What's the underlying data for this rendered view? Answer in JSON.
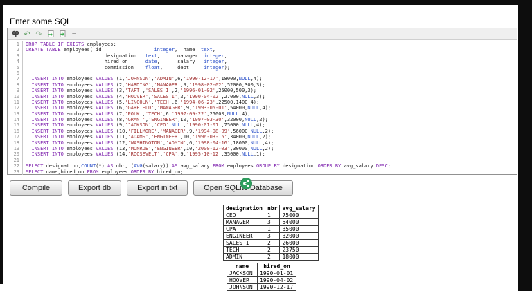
{
  "title": "Enter some SQL",
  "colors": {
    "keyword": "#7d21ad",
    "type": "#2b50c8",
    "string": "#a23333",
    "plain": "#1c1c1c",
    "accent_green": "#2e9e5e"
  },
  "editor": {
    "toolbar_icons": [
      "search",
      "undo",
      "redo",
      "load-file",
      "save-file",
      "highlight"
    ],
    "lines": [
      "DROP TABLE IF EXISTS employees;",
      "CREATE TABLE employees( id                  integer,  name  text,",
      "                           designation   text,      manager  integer,",
      "                           hired_on      date,      salary   integer,",
      "                           commission    float,     dept     integer);",
      "",
      "  INSERT INTO employees VALUES (1,'JOHNSON','ADMIN',6,'1990-12-17',18000,NULL,4);",
      "  INSERT INTO employees VALUES (2,'HARDING','MANAGER',9,'1998-02-02',52000,300,3);",
      "  INSERT INTO employees VALUES (3,'TAFT','SALES I',2,'1996-01-02',25000,500,3);",
      "  INSERT INTO employees VALUES (4,'HOOVER','SALES I',2,'1990-04-02',27000,NULL,3);",
      "  INSERT INTO employees VALUES (5,'LINCOLN','TECH',6,'1994-06-23',22500,1400,4);",
      "  INSERT INTO employees VALUES (6,'GARFIELD','MANAGER',9,'1993-05-01',54000,NULL,4);",
      "  INSERT INTO employees VALUES (7,'POLK','TECH',6,'1997-09-22',25000,NULL,4);",
      "  INSERT INTO employees VALUES (8,'GRANT','ENGINEER',10,'1997-03-30',32000,NULL,2);",
      "  INSERT INTO employees VALUES (9,'JACKSON','CEO',NULL,'1990-01-01',75000,NULL,4);",
      "  INSERT INTO employees VALUES (10,'FILLMORE','MANAGER',9,'1994-08-09',56000,NULL,2);",
      "  INSERT INTO employees VALUES (11,'ADAMS','ENGINEER',10,'1996-03-15',34000,NULL,2);",
      "  INSERT INTO employees VALUES (12,'WASHINGTON','ADMIN',6,'1998-04-16',18000,NULL,4);",
      "  INSERT INTO employees VALUES (13,'MONROE','ENGINEER',10,'2000-12-03',30000,NULL,2);",
      "  INSERT INTO employees VALUES (14,'ROOSEVELT','CPA',9,'1995-10-12',35000,NULL,1);",
      "",
      "SELECT designation,COUNT(*) AS nbr, (AVG(salary)) AS avg_salary FROM employees GROUP BY designation ORDER BY avg_salary DESC;",
      "SELECT name,hired_on FROM employees ORDER BY hired_on;"
    ]
  },
  "buttons": [
    {
      "label": "Compile"
    },
    {
      "label": "Export db"
    },
    {
      "label": "Export in txt"
    },
    {
      "label": "Open SQLite Database"
    }
  ],
  "results": [
    {
      "headers": [
        "designation",
        "nbr",
        "avg_salary"
      ],
      "rows": [
        [
          "CEO",
          "1",
          "75000"
        ],
        [
          "MANAGER",
          "3",
          "54000"
        ],
        [
          "CPA",
          "1",
          "35000"
        ],
        [
          "ENGINEER",
          "3",
          "32000"
        ],
        [
          "SALES I",
          "2",
          "26000"
        ],
        [
          "TECH",
          "2",
          "23750"
        ],
        [
          "ADMIN",
          "2",
          "18000"
        ]
      ]
    },
    {
      "headers": [
        "name",
        "hired_on"
      ],
      "rows": [
        [
          "JACKSON",
          "1990-01-01"
        ],
        [
          "HOOVER",
          "1990-04-02"
        ],
        [
          "JOHNSON",
          "1990-12-17"
        ]
      ]
    }
  ]
}
